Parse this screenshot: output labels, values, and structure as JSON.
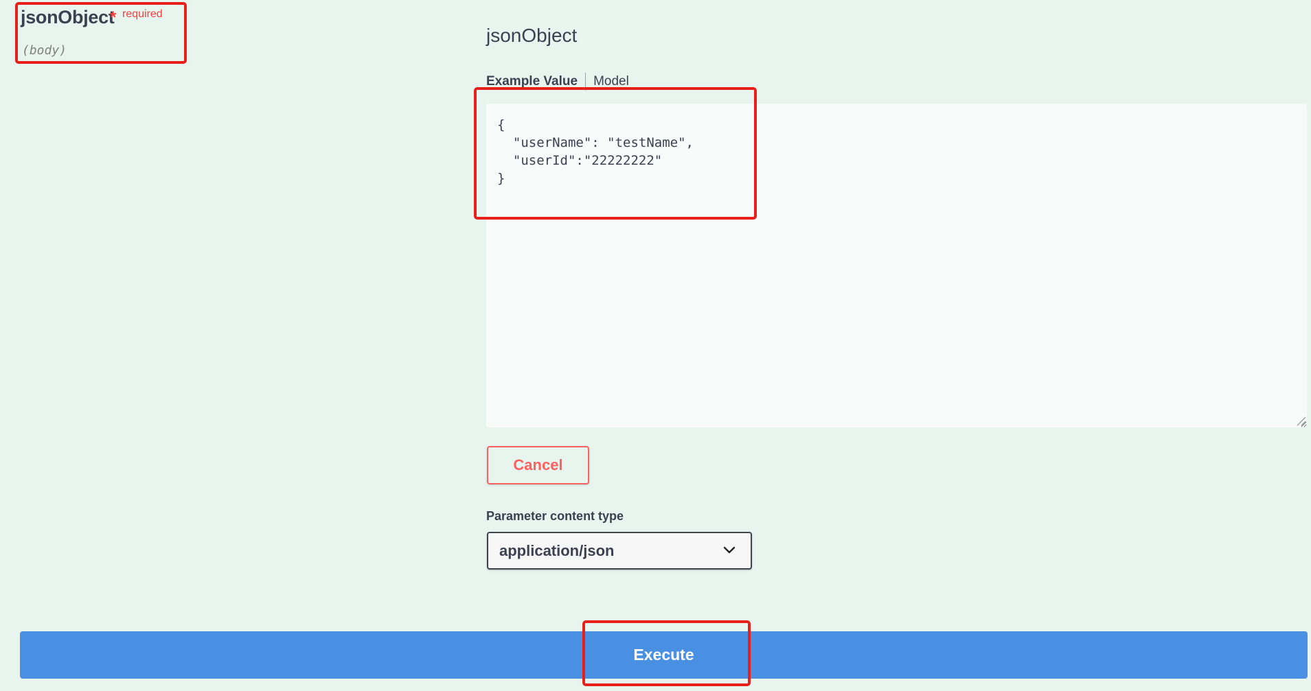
{
  "parameter": {
    "name": "jsonObject",
    "required_star": "*",
    "required_label": "required",
    "location": "(body)"
  },
  "body_panel": {
    "title": "jsonObject",
    "tabs": [
      {
        "label": "Example Value",
        "active": true
      },
      {
        "label": "Model",
        "active": false
      }
    ],
    "editor_value": "{\n  \"userName\": \"testName\",\n  \"userId\":\"22222222\"\n}",
    "cancel_label": "Cancel",
    "content_type_label": "Parameter content type",
    "content_type_value": "application/json"
  },
  "actions": {
    "execute_label": "Execute"
  },
  "colors": {
    "background": "#e8f5ef",
    "execute": "#4990e2",
    "cancel": "#ff6060",
    "required": "#f93e3e",
    "highlight": "#e8201a"
  },
  "icons": {
    "select_caret": "chevron-down-icon",
    "resize": "resize-grip-icon"
  }
}
